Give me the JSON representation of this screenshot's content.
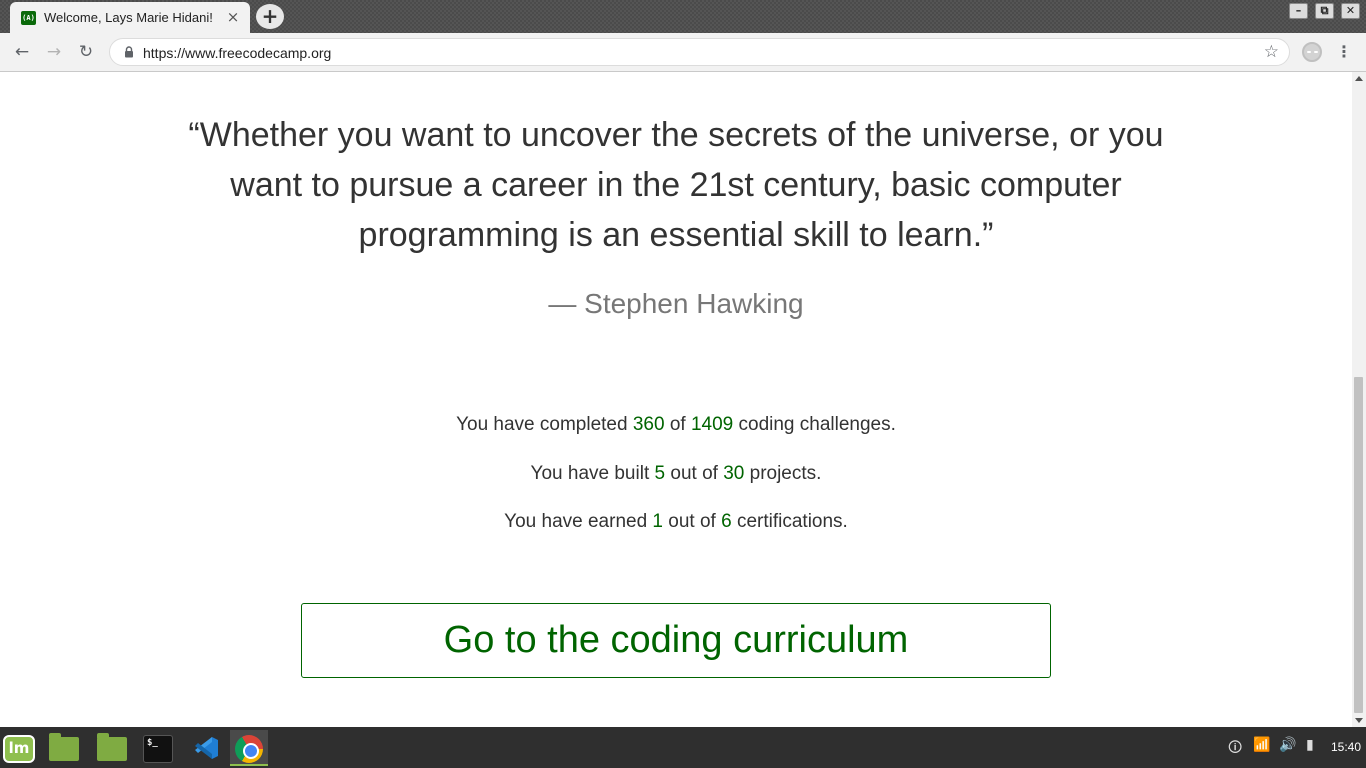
{
  "browser": {
    "tab": {
      "favicon_text": "(A)",
      "title": "Welcome, Lays Marie Hidani! | freeCodeCamp.org",
      "close_glyph": "×"
    },
    "new_tab_glyph": "+",
    "window_controls": {
      "minimize": "–",
      "restore": "⧉",
      "close": "✕"
    },
    "nav": {
      "back": "←",
      "forward": "→",
      "reload": "↻"
    },
    "address_bar": {
      "url": "https://www.freecodecamp.org",
      "star_glyph": "☆"
    },
    "menu_glyph": "⋮"
  },
  "page": {
    "quote": "“Whether you want to uncover the secrets of the universe, or you want to pursue a career in the 21st century, basic computer programming is an essential skill to learn.”",
    "attribution": "— Stephen Hawking",
    "stats": {
      "challenges": {
        "prefix": "You have completed ",
        "done": "360",
        "middle": " of ",
        "total": "1409",
        "suffix": " coding challenges."
      },
      "projects": {
        "prefix": "You have built ",
        "done": "5",
        "middle": " out of ",
        "total": "30",
        "suffix": " projects."
      },
      "certifications": {
        "prefix": "You have earned ",
        "done": "1",
        "middle": " out of ",
        "total": "6",
        "suffix": " certifications."
      }
    },
    "cta_label": "Go to the coding curriculum",
    "accent_color": "#006400"
  },
  "taskbar": {
    "terminal_glyph": "$_",
    "tray": {
      "security": "🛈",
      "wifi": "📶",
      "volume": "🔊",
      "battery": "▮"
    },
    "clock": "15:40"
  }
}
